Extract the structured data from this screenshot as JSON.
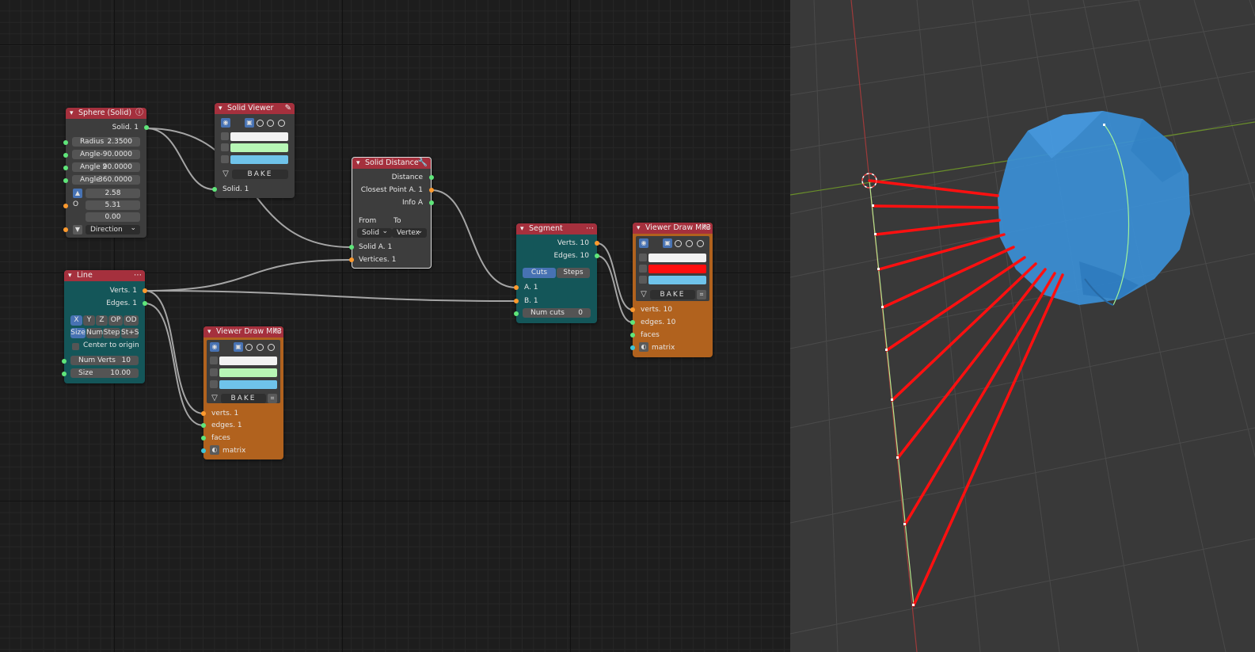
{
  "nodes": {
    "sphere": {
      "title": "Sphere (Solid)",
      "output": "Solid. 1",
      "radius_label": "Radius",
      "radius_value": "2.3500",
      "angle_label": "Angle",
      "angle_value": "-90.0000",
      "angle2_label": "Angle 2",
      "angle2_value": "90.0000",
      "angle3_label": "Angle",
      "angle3_value": "360.0000",
      "v1": "2.58",
      "v2": "5.31",
      "v3": "0.00",
      "o_label": "O",
      "direction": "Direction"
    },
    "solid_viewer": {
      "title": "Solid Viewer",
      "bake": "BAKE",
      "input": "Solid. 1"
    },
    "solid_distance": {
      "title": "Solid Distance",
      "out_distance": "Distance",
      "out_closest": "Closest Point A. 1",
      "out_info": "Info A",
      "from_label": "From",
      "to_label": "To",
      "from_value": "Solid",
      "to_value": "Vertex",
      "in_solid": "Solid A. 1",
      "in_vertices": "Vertices. 1"
    },
    "line": {
      "title": "Line",
      "out_verts": "Verts. 1",
      "out_edges": "Edges. 1",
      "axis_buttons": [
        "X",
        "Y",
        "Z",
        "OP",
        "OD"
      ],
      "mode_buttons": [
        "Size",
        "Num",
        "Step",
        "St+S"
      ],
      "center_label": "Center to origin",
      "numverts_label": "Num Verts",
      "numverts_value": "10",
      "size_label": "Size",
      "size_value": "10.00"
    },
    "viewer1": {
      "title": "Viewer Draw Mk3",
      "bake": "BAKE",
      "in_verts": "verts. 1",
      "in_edges": "edges. 1",
      "in_faces": "faces",
      "in_matrix": "matrix"
    },
    "segment": {
      "title": "Segment",
      "out_verts": "Verts. 10",
      "out_edges": "Edges. 10",
      "tab_cuts": "Cuts",
      "tab_steps": "Steps",
      "in_a": "A. 1",
      "in_b": "B. 1",
      "numcuts_label": "Num cuts",
      "numcuts_value": "0"
    },
    "viewer2": {
      "title": "Viewer Draw Mk3",
      "bake": "BAKE",
      "in_verts": "verts. 10",
      "in_edges": "edges. 10",
      "in_faces": "faces",
      "in_matrix": "matrix"
    }
  },
  "colors": {
    "swatch_white": "#f2f2f2",
    "swatch_green": "#b7f6b5",
    "swatch_blue": "#6fc3ea",
    "swatch_red": "#ff0d0d",
    "sphere": "#3b8fd6"
  },
  "icons": [
    "eye-icon",
    "cube-icon",
    "pencil-icon",
    "wrench-icon",
    "funnel-icon",
    "matrix-icon",
    "info-icon"
  ]
}
